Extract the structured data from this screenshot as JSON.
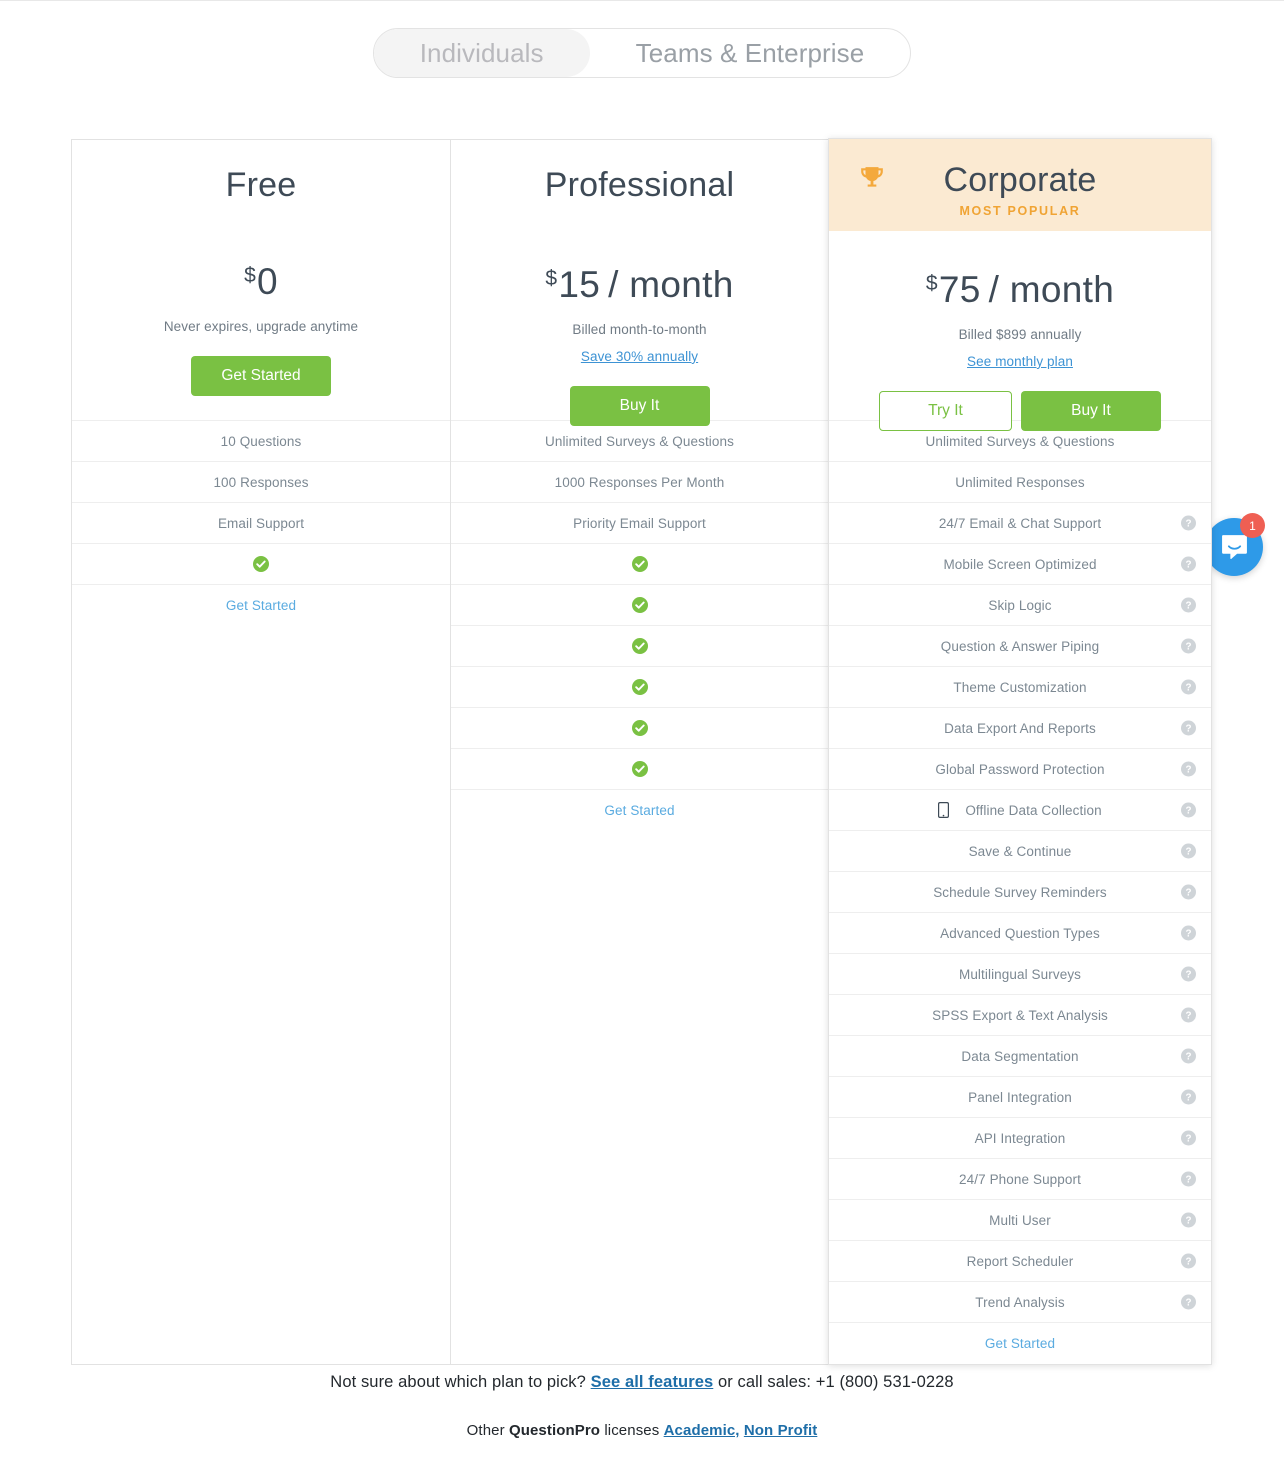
{
  "toggle": {
    "options": [
      {
        "label": "Individuals",
        "active": true
      },
      {
        "label": "Teams & Enterprise",
        "active": false
      }
    ]
  },
  "colors": {
    "green": "#7ac143",
    "link_blue": "#3d93d4",
    "row_link_blue": "#5aabe0",
    "popular_bg": "#fbead2",
    "popular_orange": "#f0a434",
    "text_gray": "#7c8892",
    "heading": "#3e4a56",
    "intercom_blue": "#2e9ae8",
    "badge_red": "#ef5f53"
  },
  "plans": [
    {
      "id": "free",
      "name": "Free",
      "currency": "$",
      "price": "0",
      "period": "",
      "billed": "Never expires, upgrade anytime",
      "annual_link": "",
      "buttons": [
        {
          "label": "Get Started",
          "style": "solid"
        }
      ],
      "badge": null,
      "features": [
        {
          "label": "10 Questions",
          "type": "text",
          "help": false
        },
        {
          "label": "100 Responses",
          "type": "text",
          "help": false
        },
        {
          "label": "Email Support",
          "type": "text",
          "help": false
        },
        {
          "label": "",
          "type": "check",
          "help": false
        },
        {
          "label": "Get Started",
          "type": "link",
          "help": false
        }
      ]
    },
    {
      "id": "professional",
      "name": "Professional",
      "currency": "$",
      "price": "15",
      "period": "/ month",
      "billed": "Billed month-to-month",
      "annual_link": "Save 30% annually",
      "buttons": [
        {
          "label": "Buy It",
          "style": "solid"
        }
      ],
      "badge": null,
      "features": [
        {
          "label": "Unlimited Surveys & Questions",
          "type": "text",
          "help": false
        },
        {
          "label": "1000 Responses Per Month",
          "type": "text",
          "help": false
        },
        {
          "label": "Priority Email Support",
          "type": "text",
          "help": false
        },
        {
          "label": "",
          "type": "check",
          "help": false
        },
        {
          "label": "",
          "type": "check",
          "help": false
        },
        {
          "label": "",
          "type": "check",
          "help": false
        },
        {
          "label": "",
          "type": "check",
          "help": false
        },
        {
          "label": "",
          "type": "check",
          "help": false
        },
        {
          "label": "",
          "type": "check",
          "help": false
        },
        {
          "label": "Get Started",
          "type": "link",
          "help": false
        }
      ]
    },
    {
      "id": "corporate",
      "name": "Corporate",
      "currency": "$",
      "price": "75",
      "period": "/ month",
      "billed": "Billed $899 annually",
      "annual_link": "See monthly plan",
      "buttons": [
        {
          "label": "Try It",
          "style": "outline"
        },
        {
          "label": "Buy It",
          "style": "solid"
        }
      ],
      "badge": {
        "label": "MOST POPULAR",
        "icon": "trophy-icon"
      },
      "features": [
        {
          "label": "Unlimited Surveys & Questions",
          "type": "text",
          "help": false
        },
        {
          "label": "Unlimited Responses",
          "type": "text",
          "help": false
        },
        {
          "label": "24/7 Email & Chat Support",
          "type": "text",
          "help": true
        },
        {
          "label": "Mobile Screen Optimized",
          "type": "text",
          "help": true
        },
        {
          "label": "Skip Logic",
          "type": "text",
          "help": true
        },
        {
          "label": "Question & Answer Piping",
          "type": "text",
          "help": true
        },
        {
          "label": "Theme Customization",
          "type": "text",
          "help": true
        },
        {
          "label": "Data Export And Reports",
          "type": "text",
          "help": true
        },
        {
          "label": "Global Password Protection",
          "type": "text",
          "help": true
        },
        {
          "label": "Offline Data Collection",
          "type": "text",
          "help": true,
          "icon": "mobile-phone-icon"
        },
        {
          "label": "Save & Continue",
          "type": "text",
          "help": true
        },
        {
          "label": "Schedule Survey Reminders",
          "type": "text",
          "help": true
        },
        {
          "label": "Advanced Question Types",
          "type": "text",
          "help": true
        },
        {
          "label": "Multilingual Surveys",
          "type": "text",
          "help": true
        },
        {
          "label": "SPSS Export & Text Analysis",
          "type": "text",
          "help": true
        },
        {
          "label": "Data Segmentation",
          "type": "text",
          "help": true
        },
        {
          "label": "Panel Integration",
          "type": "text",
          "help": true
        },
        {
          "label": "API Integration",
          "type": "text",
          "help": true
        },
        {
          "label": "24/7 Phone Support",
          "type": "text",
          "help": true
        },
        {
          "label": "Multi User",
          "type": "text",
          "help": true
        },
        {
          "label": "Report Scheduler",
          "type": "text",
          "help": true
        },
        {
          "label": "Trend Analysis",
          "type": "text",
          "help": true
        },
        {
          "label": "Get Started",
          "type": "link",
          "help": false
        }
      ]
    }
  ],
  "footer": {
    "line1_before": "Not sure about which plan to pick?",
    "line1_link": "See all features",
    "line1_after": "or call sales: +1 (800) 531-0228",
    "line2_before": "Other",
    "line2_brand": "QuestionPro",
    "line2_mid": "licenses",
    "line2_link1": "Academic,",
    "line2_link2": "Non Profit"
  },
  "intercom": {
    "badge_count": "1"
  }
}
